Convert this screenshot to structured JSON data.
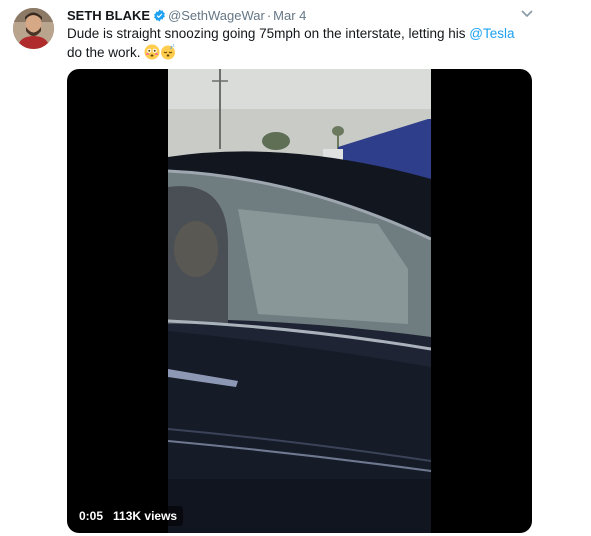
{
  "tweet": {
    "author_name": "SETH BLAKE",
    "handle": "@SethWageWar",
    "separator": "·",
    "date": "Mar 4",
    "text_before": "Dude is straight snoozing going 75mph on the interstate, letting his ",
    "mention": "@Tesla",
    "text_after": " do the work."
  },
  "video": {
    "duration": "0:05",
    "views": "113K views"
  },
  "icons": [
    "avatar",
    "verified-badge-icon",
    "chevron-down-icon",
    "flushed-face-emoji",
    "sleeping-face-emoji"
  ],
  "colors": {
    "mention": "#1da1f2",
    "verified": "#1da1f2",
    "meta": "#657786"
  }
}
